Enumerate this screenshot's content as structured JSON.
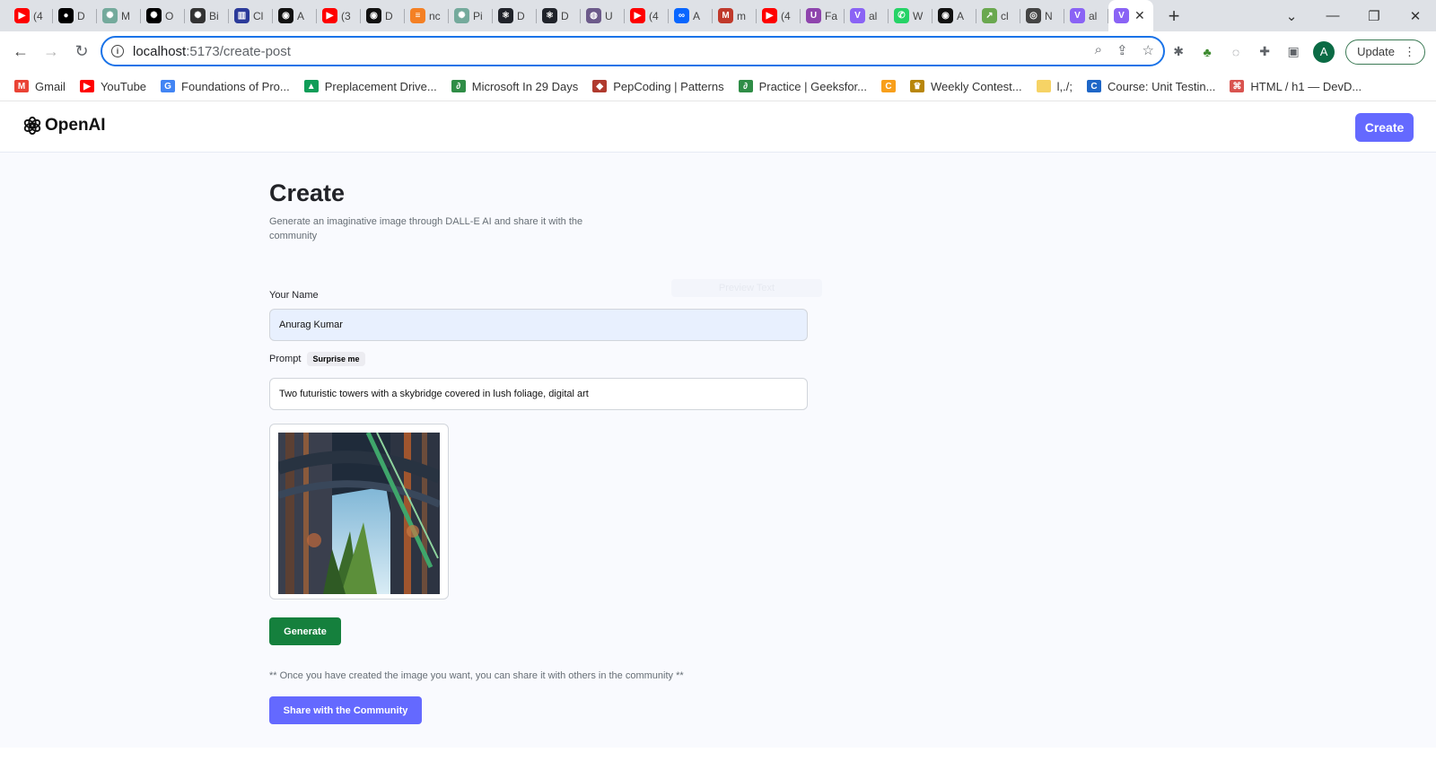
{
  "browser": {
    "tabs": [
      {
        "title": "(4",
        "icon": "youtube-icon",
        "color": "#ff0000",
        "glyph": "▶"
      },
      {
        "title": "D",
        "icon": "dark-circle-icon",
        "color": "#000000",
        "glyph": "●"
      },
      {
        "title": "M",
        "icon": "chatgpt-icon",
        "color": "#74aa9c",
        "glyph": "✺"
      },
      {
        "title": "O",
        "icon": "openai-icon",
        "color": "#000000",
        "glyph": "✺"
      },
      {
        "title": "Bi",
        "icon": "openai-icon",
        "color": "#333333",
        "glyph": "✺"
      },
      {
        "title": "Cl",
        "icon": "chart-icon",
        "color": "#2b3a9a",
        "glyph": "▥"
      },
      {
        "title": "A",
        "icon": "github-icon",
        "color": "#111111",
        "glyph": "◉"
      },
      {
        "title": "(3",
        "icon": "youtube-icon",
        "color": "#ff0000",
        "glyph": "▶"
      },
      {
        "title": "D",
        "icon": "github-icon",
        "color": "#111111",
        "glyph": "◉"
      },
      {
        "title": "nc",
        "icon": "stackoverflow-icon",
        "color": "#f48024",
        "glyph": "≡"
      },
      {
        "title": "Pi",
        "icon": "chatgpt-icon",
        "color": "#74aa9c",
        "glyph": "✺"
      },
      {
        "title": "D",
        "icon": "react-icon",
        "color": "#20232a",
        "glyph": "⚛"
      },
      {
        "title": "D",
        "icon": "react-icon",
        "color": "#20232a",
        "glyph": "⚛"
      },
      {
        "title": "U",
        "icon": "circle-icon",
        "color": "#6c5a8a",
        "glyph": "◍"
      },
      {
        "title": "(4",
        "icon": "youtube-icon",
        "color": "#ff0000",
        "glyph": "▶"
      },
      {
        "title": "A",
        "icon": "meta-icon",
        "color": "#0866ff",
        "glyph": "∞"
      },
      {
        "title": "m",
        "icon": "mongodb-icon",
        "color": "#c0392b",
        "glyph": "M"
      },
      {
        "title": "(4",
        "icon": "youtube-icon",
        "color": "#ff0000",
        "glyph": "▶"
      },
      {
        "title": "Fa",
        "icon": "u-icon",
        "color": "#8e44ad",
        "glyph": "U"
      },
      {
        "title": "al",
        "icon": "vite-icon",
        "color": "#8a63f5",
        "glyph": "V"
      },
      {
        "title": "W",
        "icon": "whatsapp-icon",
        "color": "#25d366",
        "glyph": "✆"
      },
      {
        "title": "A",
        "icon": "github-icon",
        "color": "#111111",
        "glyph": "◉"
      },
      {
        "title": "cl",
        "icon": "trend-icon",
        "color": "#6aa84f",
        "glyph": "↗"
      },
      {
        "title": "N",
        "icon": "chrome-icon",
        "color": "#444444",
        "glyph": "◎"
      },
      {
        "title": "al",
        "icon": "vite-icon",
        "color": "#8a63f5",
        "glyph": "V"
      }
    ],
    "active_tab": {
      "icon": "vite-icon",
      "color": "#8a63f5",
      "glyph": "V"
    },
    "url_host": "localhost",
    "url_path": ":5173/create-post",
    "update_label": "Update",
    "avatar_letter": "A",
    "bookmarks": [
      {
        "label": "Gmail",
        "icon": "gmail-icon",
        "color": "#ea4335",
        "glyph": "M"
      },
      {
        "label": "YouTube",
        "icon": "youtube-icon",
        "color": "#ff0000",
        "glyph": "▶"
      },
      {
        "label": "Foundations of Pro...",
        "icon": "google-icon",
        "color": "#4285f4",
        "glyph": "G"
      },
      {
        "label": "Preplacement Drive...",
        "icon": "google-drive-icon",
        "color": "#0f9d58",
        "glyph": "▲"
      },
      {
        "label": "Microsoft In 29 Days",
        "icon": "geeksforgeeks-icon",
        "color": "#2f8d46",
        "glyph": "∂"
      },
      {
        "label": "PepCoding | Patterns",
        "icon": "pepcoding-icon",
        "color": "#b03a2e",
        "glyph": "◆"
      },
      {
        "label": "Practice | Geeksfor...",
        "icon": "geeksforgeeks-icon",
        "color": "#2f8d46",
        "glyph": "∂"
      },
      {
        "label": "",
        "icon": "leetcode-icon",
        "color": "#f89f1b",
        "glyph": "C"
      },
      {
        "label": "Weekly Contest...",
        "icon": "trophy-icon",
        "color": "#b8860b",
        "glyph": "♛"
      },
      {
        "label": "l,./;",
        "icon": "folder-icon",
        "color": "#f6d365",
        "glyph": ""
      },
      {
        "label": "Course: Unit Testin...",
        "icon": "course-icon",
        "color": "#1e66c7",
        "glyph": "C"
      },
      {
        "label": "HTML / h1 — DevD...",
        "icon": "devdocs-icon",
        "color": "#d9534f",
        "glyph": "⌘"
      }
    ]
  },
  "app": {
    "logo_text": "OpenAI",
    "header_create_label": "Create",
    "title": "Create",
    "subtitle": "Generate an imaginative image through DALL-E AI and share it with the community",
    "ghost_text": "Preview Text",
    "name_label": "Your Name",
    "name_value": "Anurag Kumar",
    "prompt_label": "Prompt",
    "surprise_label": "Surprise me",
    "prompt_value": "Two futuristic towers with a skybridge covered in lush foliage, digital art",
    "generate_label": "Generate",
    "share_note": "** Once you have created the image you want, you can share it with others in the community **",
    "share_label": "Share with the Community",
    "colors": {
      "primary": "#6469ff",
      "generate": "#15803d",
      "page_bg": "#f9fafe"
    }
  }
}
